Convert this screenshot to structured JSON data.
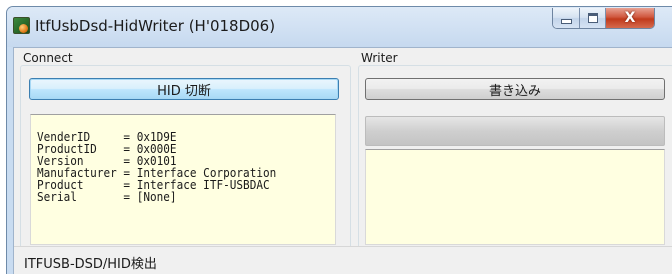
{
  "window": {
    "title": "ItfUsbDsd-HidWriter (H'018D06)",
    "icon": "app-icon",
    "controls": {
      "minimize_icon": "minimize-icon",
      "maximize_icon": "maximize-icon",
      "close_label": "X"
    }
  },
  "connect": {
    "group_label": "Connect",
    "button_label": "HID 切断",
    "info_lines": [
      "VenderID     = 0x1D9E",
      "ProductID    = 0x000E",
      "Version      = 0x0101",
      "Manufacturer = Interface Corporation",
      "Product      = Interface ITF-USBDAC",
      "Serial       = [None]"
    ]
  },
  "writer": {
    "group_label": "Writer",
    "button_label": "書き込み",
    "progress": 0
  },
  "status": {
    "text": "ITFUSB-DSD/HID検出"
  },
  "colors": {
    "info_bg": "#ffffe1",
    "client_bg": "#f0f0f0",
    "frame": "#c9dcf1",
    "close_red": "#c13a1c"
  }
}
